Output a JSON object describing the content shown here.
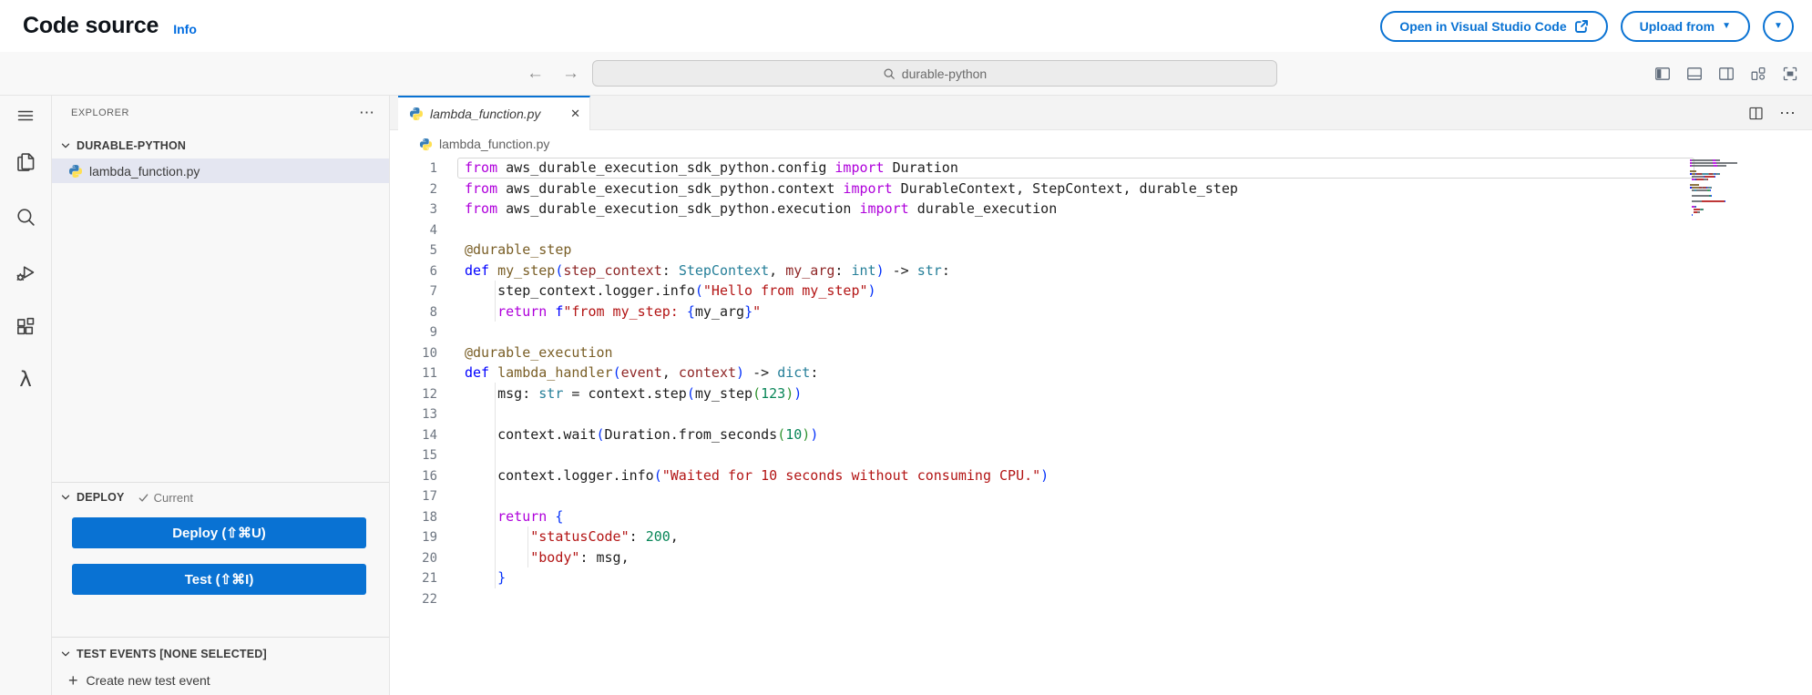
{
  "header": {
    "title": "Code source",
    "info": "Info",
    "open_vscode": "Open in Visual Studio Code",
    "upload_from": "Upload from"
  },
  "command_bar": {
    "back": "←",
    "forward": "→",
    "search": "durable-python"
  },
  "glyphs": {
    "more": "⋯",
    "close": "✕",
    "plus": "+",
    "caret": "▼",
    "lambda": "λ"
  },
  "sidebar": {
    "explorer": "EXPLORER",
    "workspace": "DURABLE-PYTHON",
    "file": "lambda_function.py",
    "deploy_title": "DEPLOY",
    "deploy_status": "Current",
    "deploy_btn": "Deploy (⇧⌘U)",
    "test_btn": "Test (⇧⌘I)",
    "test_events_title": "TEST EVENTS [NONE SELECTED]",
    "create_test_event": "Create new test event"
  },
  "colors": {
    "accent_blue": "#0972d3",
    "link_blue": "#006ce0",
    "selection_bg": "#e4e6f1"
  },
  "editor": {
    "tab": "lambda_function.py",
    "breadcrumb": "lambda_function.py",
    "token_colors": {
      "kw": "#af00db",
      "df": "#0000ff",
      "fn": "#795e26",
      "dc": "#795e26",
      "pr": "#8f2727",
      "ty": "#267f99",
      "st": "#b31515",
      "nu": "#098658",
      "b1": "#0431fa",
      "b2": "#319331",
      "pl": "#1e1e1e"
    },
    "code": [
      [
        [
          "from",
          "kw"
        ],
        [
          " aws_durable_execution_sdk_python.config ",
          "pl"
        ],
        [
          "import",
          "kw"
        ],
        [
          " Duration",
          "pl"
        ]
      ],
      [
        [
          "from",
          "kw"
        ],
        [
          " aws_durable_execution_sdk_python.context ",
          "pl"
        ],
        [
          "import",
          "kw"
        ],
        [
          " DurableContext, StepContext, durable_step",
          "pl"
        ]
      ],
      [
        [
          "from",
          "kw"
        ],
        [
          " aws_durable_execution_sdk_python.execution ",
          "pl"
        ],
        [
          "import",
          "kw"
        ],
        [
          " durable_execution",
          "pl"
        ]
      ],
      [],
      [
        [
          "@durable_step",
          "dc"
        ]
      ],
      [
        [
          "def",
          "df"
        ],
        [
          " ",
          "pl"
        ],
        [
          "my_step",
          "fn"
        ],
        [
          "(",
          "b1"
        ],
        [
          "step_context",
          "pr"
        ],
        [
          ": ",
          "pl"
        ],
        [
          "StepContext",
          "ty"
        ],
        [
          ", ",
          "pl"
        ],
        [
          "my_arg",
          "pr"
        ],
        [
          ": ",
          "pl"
        ],
        [
          "int",
          "ty"
        ],
        [
          ")",
          "b1"
        ],
        [
          " -> ",
          "pl"
        ],
        [
          "str",
          "ty"
        ],
        [
          ":",
          "pl"
        ]
      ],
      [
        [
          "    step_context.logger.info",
          "pl"
        ],
        [
          "(",
          "b1"
        ],
        [
          "\"Hello from my_step\"",
          "st"
        ],
        [
          ")",
          "b1"
        ]
      ],
      [
        [
          "    ",
          "pl"
        ],
        [
          "return",
          "kw"
        ],
        [
          " ",
          "pl"
        ],
        [
          "f",
          "df"
        ],
        [
          "\"from my_step: ",
          "st"
        ],
        [
          "{",
          "b1"
        ],
        [
          "my_arg",
          "pl"
        ],
        [
          "}",
          "b1"
        ],
        [
          "\"",
          "st"
        ]
      ],
      [],
      [
        [
          "@durable_execution",
          "dc"
        ]
      ],
      [
        [
          "def",
          "df"
        ],
        [
          " ",
          "pl"
        ],
        [
          "lambda_handler",
          "fn"
        ],
        [
          "(",
          "b1"
        ],
        [
          "event",
          "pr"
        ],
        [
          ", ",
          "pl"
        ],
        [
          "context",
          "pr"
        ],
        [
          ")",
          "b1"
        ],
        [
          " -> ",
          "pl"
        ],
        [
          "dict",
          "ty"
        ],
        [
          ":",
          "pl"
        ]
      ],
      [
        [
          "    msg: ",
          "pl"
        ],
        [
          "str",
          "ty"
        ],
        [
          " = context.step",
          "pl"
        ],
        [
          "(",
          "b1"
        ],
        [
          "my_step",
          "pl"
        ],
        [
          "(",
          "b2"
        ],
        [
          "123",
          "nu"
        ],
        [
          ")",
          "b2"
        ],
        [
          ")",
          "b1"
        ]
      ],
      [],
      [
        [
          "    context.wait",
          "pl"
        ],
        [
          "(",
          "b1"
        ],
        [
          "Duration.from_seconds",
          "pl"
        ],
        [
          "(",
          "b2"
        ],
        [
          "10",
          "nu"
        ],
        [
          ")",
          "b2"
        ],
        [
          ")",
          "b1"
        ]
      ],
      [],
      [
        [
          "    context.logger.info",
          "pl"
        ],
        [
          "(",
          "b1"
        ],
        [
          "\"Waited for 10 seconds without consuming CPU.\"",
          "st"
        ],
        [
          ")",
          "b1"
        ]
      ],
      [],
      [
        [
          "    ",
          "pl"
        ],
        [
          "return",
          "kw"
        ],
        [
          " ",
          "pl"
        ],
        [
          "{",
          "b1"
        ]
      ],
      [
        [
          "        ",
          "pl"
        ],
        [
          "\"statusCode\"",
          "st"
        ],
        [
          ": ",
          "pl"
        ],
        [
          "200",
          "nu"
        ],
        [
          ",",
          "pl"
        ]
      ],
      [
        [
          "        ",
          "pl"
        ],
        [
          "\"body\"",
          "st"
        ],
        [
          ": ",
          "pl"
        ],
        [
          "msg,",
          "pl"
        ]
      ],
      [
        [
          "    ",
          "pl"
        ],
        [
          "}",
          "b1"
        ]
      ],
      []
    ]
  }
}
